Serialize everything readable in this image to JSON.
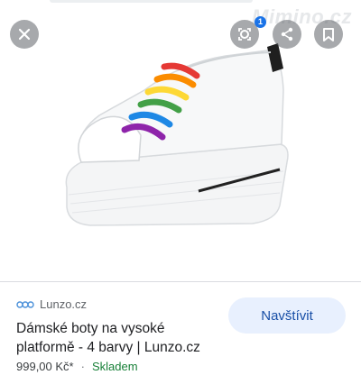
{
  "watermark": "Mimino.cz",
  "toolbar": {
    "lens_badge": "1"
  },
  "result": {
    "source": "Lunzo.cz",
    "title": "Dámské boty na vysoké platformě - 4 barvy | Lunzo.cz",
    "price": "999,00 Kč*",
    "separator": "·",
    "stock": "Skladem",
    "visit_label": "Navštívit"
  },
  "colors": {
    "accent": "#1a73e8",
    "stock_green": "#188038",
    "visit_bg": "#e8f0fe"
  }
}
